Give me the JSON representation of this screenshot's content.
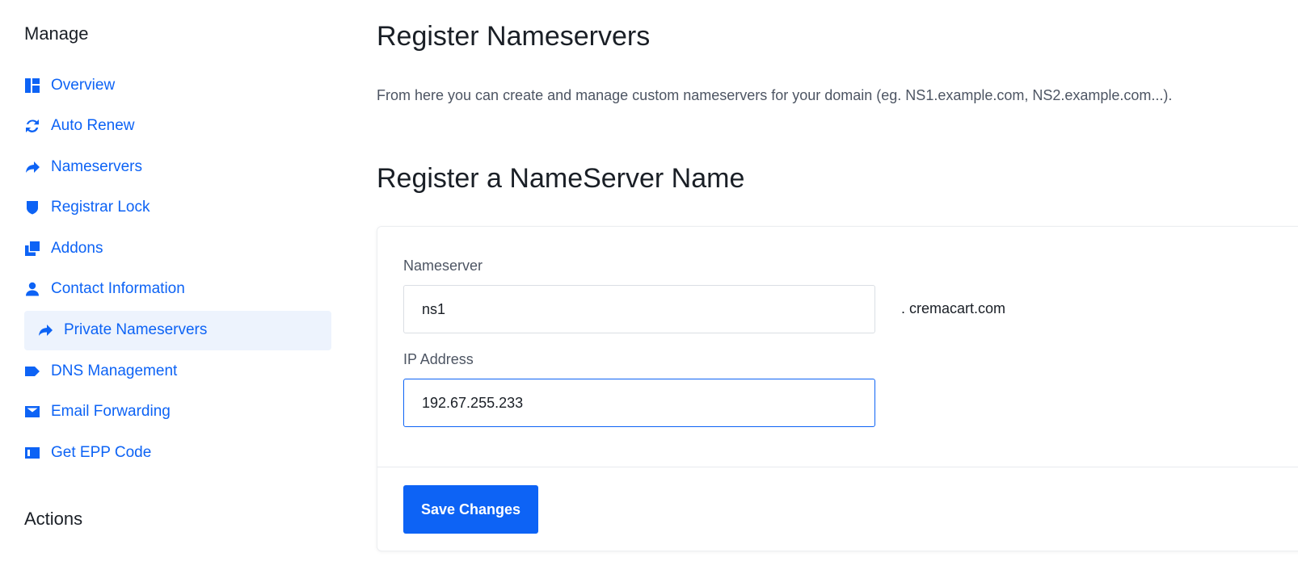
{
  "sidebar": {
    "manage_heading": "Manage",
    "actions_heading": "Actions",
    "items": [
      {
        "label": "Overview",
        "icon": "dashboard-icon"
      },
      {
        "label": "Auto Renew",
        "icon": "sync-icon"
      },
      {
        "label": "Nameservers",
        "icon": "share-arrow-icon"
      },
      {
        "label": "Registrar Lock",
        "icon": "shield-icon"
      },
      {
        "label": "Addons",
        "icon": "clone-icon"
      },
      {
        "label": "Contact Information",
        "icon": "user-icon"
      },
      {
        "label": "Private Nameservers",
        "icon": "share-arrow-icon",
        "active": true
      },
      {
        "label": "DNS Management",
        "icon": "tag-icon"
      },
      {
        "label": "Email Forwarding",
        "icon": "envelope-icon"
      },
      {
        "label": "Get EPP Code",
        "icon": "id-card-icon"
      }
    ]
  },
  "main": {
    "title": "Register Nameservers",
    "description": "From here you can create and manage custom nameservers for your domain (eg. NS1.example.com, NS2.example.com...).",
    "section_title": "Register a NameServer Name",
    "form": {
      "nameserver_label": "Nameserver",
      "nameserver_value": "ns1",
      "domain_suffix": ". cremacart.com",
      "ip_label": "IP Address",
      "ip_value": "192.67.255.233",
      "save_label": "Save Changes"
    }
  },
  "colors": {
    "accent": "#0d63f5",
    "active_bg": "#edf3fd",
    "text_dark": "#1a1f26",
    "text_muted": "#4d5563"
  }
}
